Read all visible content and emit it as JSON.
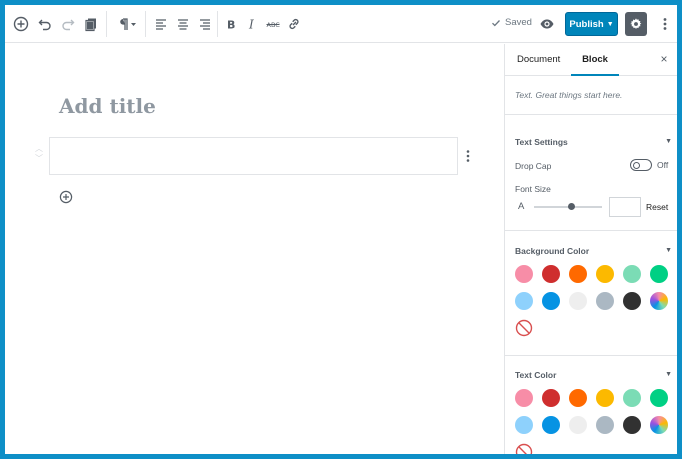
{
  "toolbar": {
    "saved_label": "Saved",
    "publish_label": "Publish",
    "tools": [
      "add-block",
      "undo",
      "redo",
      "copy",
      "paragraph",
      "align-left",
      "align-center",
      "align-right",
      "bold",
      "italic",
      "strikethrough",
      "link"
    ]
  },
  "editor": {
    "title_placeholder": "Add title"
  },
  "sidebar": {
    "tabs": [
      {
        "label": "Document",
        "active": false
      },
      {
        "label": "Block",
        "active": true
      }
    ],
    "close_label": "×",
    "block_description": "Text. Great things start here.",
    "text_settings": {
      "title": "Text Settings",
      "drop_cap_label": "Drop Cap",
      "drop_cap_state": "Off",
      "font_size_label": "Font Size",
      "font_size_glyph": "A",
      "font_size_value_fraction": 0.55,
      "reset_label": "Reset"
    },
    "background_color": {
      "title": "Background Color",
      "swatches": [
        "#f78da7",
        "#cf2e2e",
        "#ff6900",
        "#fcb900",
        "#7bdcb5",
        "#00d084",
        "#8ed1fc",
        "#0693e3",
        "#eeeeee",
        "#abb8c3",
        "#313131",
        "gradient"
      ]
    },
    "text_color": {
      "title": "Text Color",
      "swatches": [
        "#f78da7",
        "#cf2e2e",
        "#ff6900",
        "#fcb900",
        "#7bdcb5",
        "#00d084",
        "#8ed1fc",
        "#0693e3",
        "#eeeeee",
        "#abb8c3",
        "#313131",
        "gradient"
      ]
    }
  },
  "colors": {
    "frame": "#0e8fc7",
    "accent": "#0085ba",
    "no_color_icon": "#d94f4f"
  }
}
